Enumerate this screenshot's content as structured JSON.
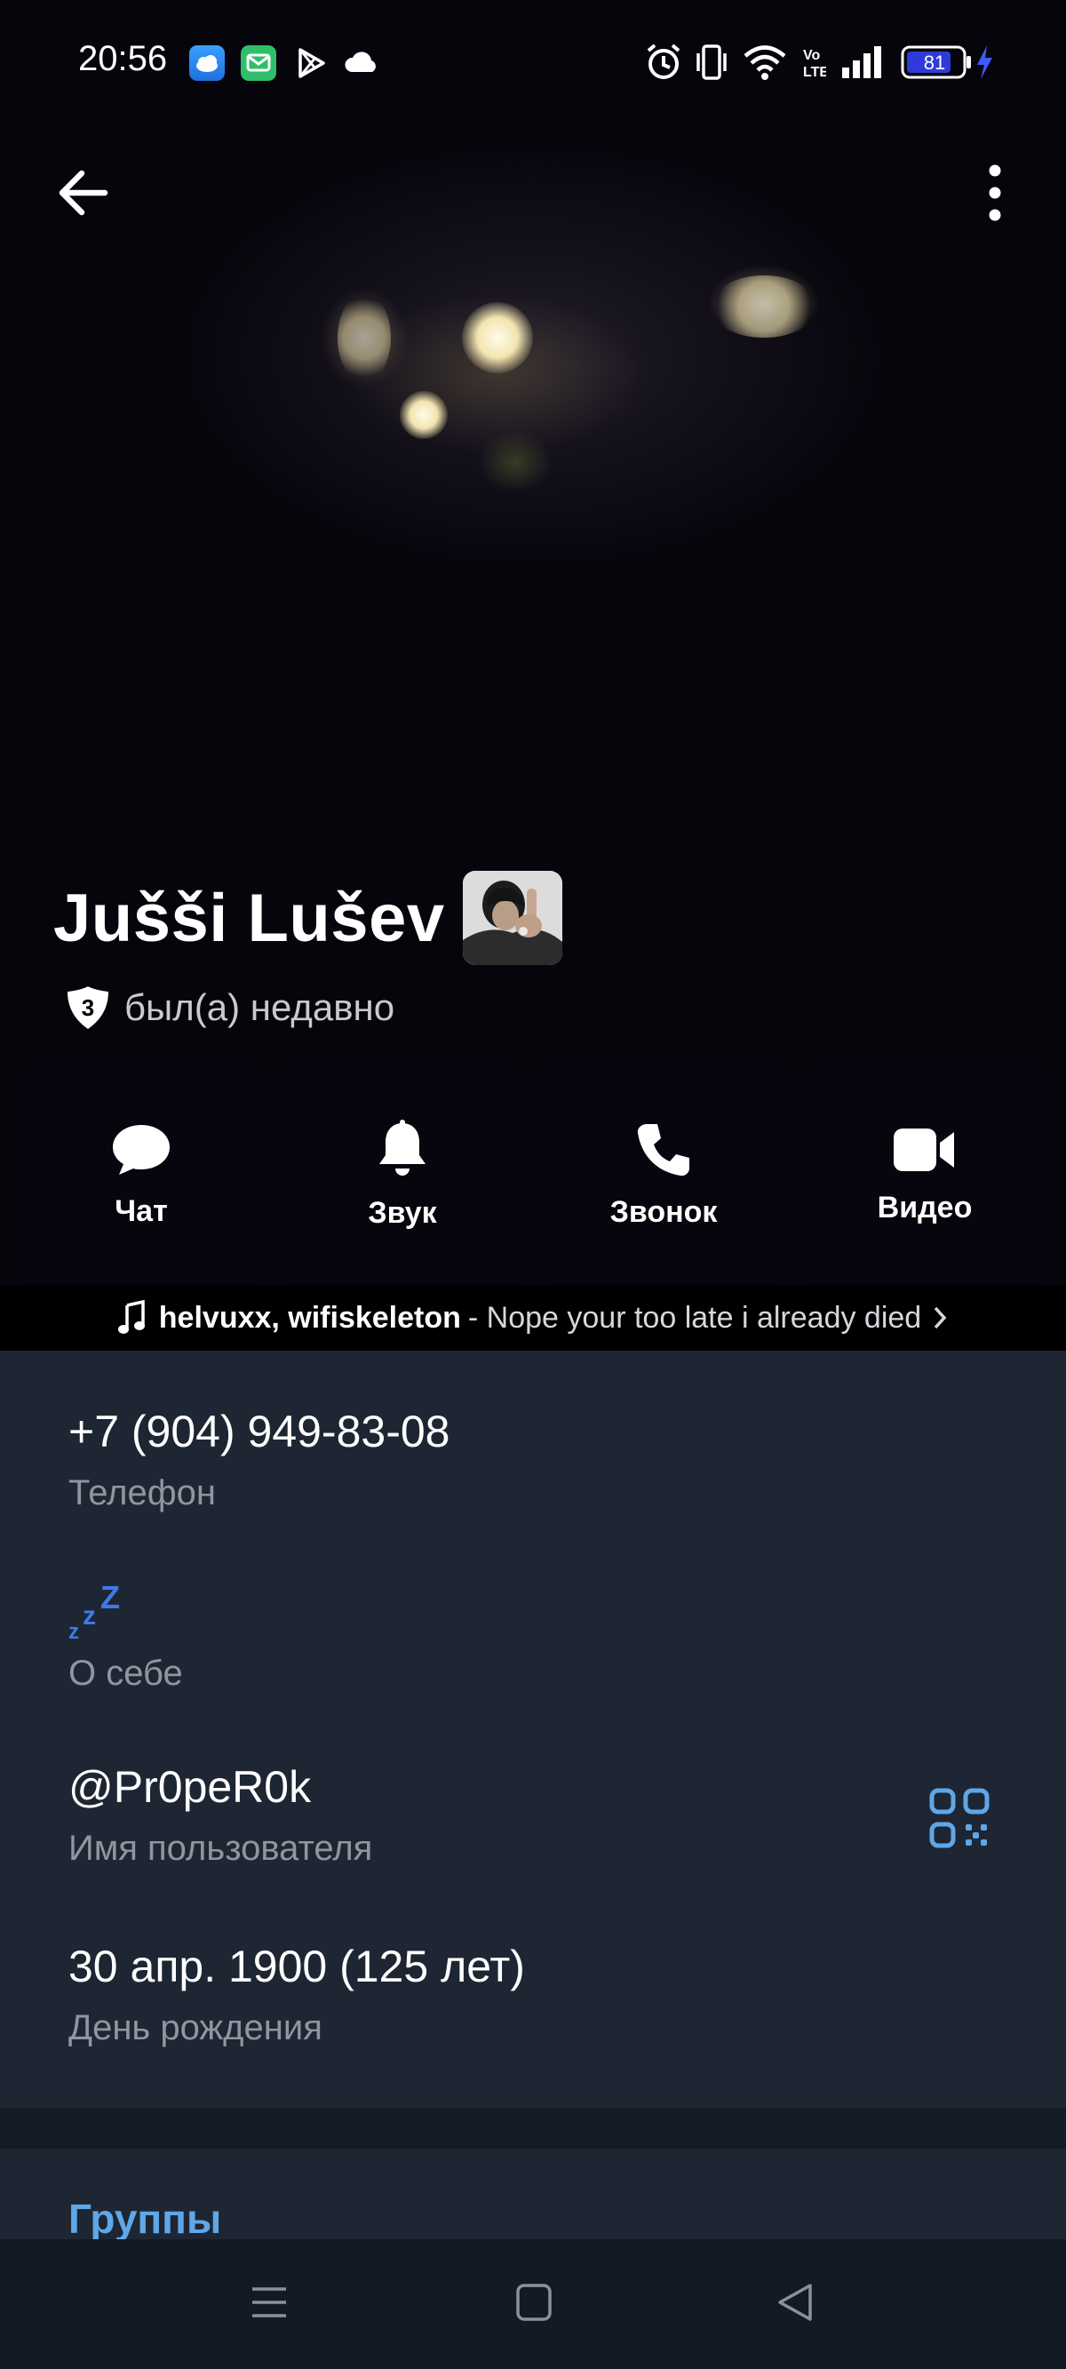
{
  "status_bar": {
    "time": "20:56",
    "battery": "81",
    "app_icons": [
      "weather-app-icon",
      "messages-app-icon",
      "play-store-icon",
      "cloud-icon"
    ],
    "system_icons": [
      "alarm-icon",
      "vibrate-icon",
      "wifi-icon",
      "volte-icon",
      "signal-icon",
      "battery-icon",
      "charging-icon"
    ]
  },
  "header": {
    "back_icon": "arrow-left-icon",
    "menu_icon": "more-vertical-icon"
  },
  "profile": {
    "name": "Juššі Lušev",
    "badge_number": "3",
    "status": "был(а) недавно"
  },
  "actions": [
    {
      "label": "Чат",
      "icon": "chat-bubble-icon"
    },
    {
      "label": "Звук",
      "icon": "bell-icon"
    },
    {
      "label": "Звонок",
      "icon": "phone-icon"
    },
    {
      "label": "Видео",
      "icon": "video-camera-icon"
    }
  ],
  "music": {
    "artist": "helvuxx, wifiskeleton",
    "title": "- Nope your too late i already died",
    "icon": "music-note-icon"
  },
  "info": {
    "phone_value": "+7 (904) 949-83-08",
    "phone_label": "Телефон",
    "about_value": "zzZ",
    "about_label": "О себе",
    "username_value": "@Pr0peR0k",
    "username_label": "Имя пользователя",
    "birthday_value": "30 апр. 1900 (125 лет)",
    "birthday_label": "День рождения"
  },
  "groups": {
    "title": "Группы"
  },
  "colors": {
    "panel_bg": "#1e2633",
    "accent": "#5ea7e8",
    "secondary_text": "#8e969f"
  },
  "nav_bar": [
    "menu-nav-icon",
    "home-nav-icon",
    "back-nav-icon"
  ]
}
